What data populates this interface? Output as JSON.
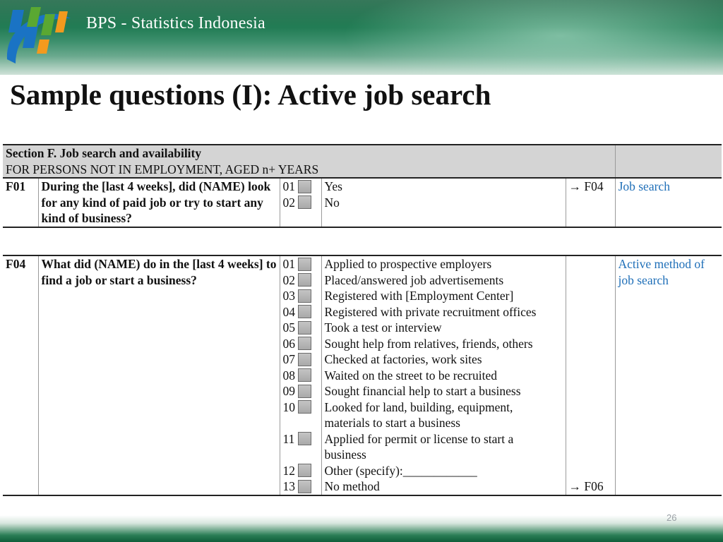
{
  "header": {
    "org_name": "BPS - Statistics Indonesia",
    "colors": {
      "band": "#1f7a52",
      "logo_blue": "#1a73c4",
      "logo_green": "#5aa832",
      "logo_orange": "#f39a1e"
    }
  },
  "slide": {
    "title": "Sample questions (I): Active job search",
    "page_number": "26"
  },
  "table1": {
    "section_name": "Section F. Job search and availability",
    "section_sub": "FOR PERSONS NOT IN EMPLOYMENT, AGED n+ YEARS",
    "row": {
      "code": "F01",
      "question": "During the [last 4 weeks], did (NAME) look for any kind of paid job or try to start any kind of business?",
      "options": [
        {
          "num": "01",
          "label": "Yes",
          "skip": "→ F04"
        },
        {
          "num": "02",
          "label": "No",
          "skip": ""
        }
      ],
      "topic": "Job search"
    }
  },
  "table2": {
    "row": {
      "code": "F04",
      "question": "What did (NAME) do in the [last 4 weeks] to find a job or start a business?",
      "topic": "Active method of job search",
      "options": [
        {
          "num": "01",
          "label": "Applied to prospective employers"
        },
        {
          "num": "02",
          "label": "Placed/answered job advertisements"
        },
        {
          "num": "03",
          "label": "Registered with [Employment Center]"
        },
        {
          "num": "04",
          "label": "Registered with private recruitment offices"
        },
        {
          "num": "05",
          "label": "Took a test or interview"
        },
        {
          "num": "06",
          "label": "Sought help from relatives, friends, others"
        },
        {
          "num": "07",
          "label": "Checked at factories, work sites"
        },
        {
          "num": "08",
          "label": "Waited on the street to be recruited"
        },
        {
          "num": "09",
          "label": "Sought financial help to start a business"
        },
        {
          "num": "10",
          "label": "Looked for land, building, equipment,",
          "label2": "materials to start a business"
        },
        {
          "num": "11",
          "label": "Applied for permit or license to start a",
          "label2": "business"
        },
        {
          "num": "12",
          "label": "Other (specify):____________"
        },
        {
          "num": "13",
          "label": "No method",
          "skip": "→ F06"
        }
      ]
    }
  }
}
